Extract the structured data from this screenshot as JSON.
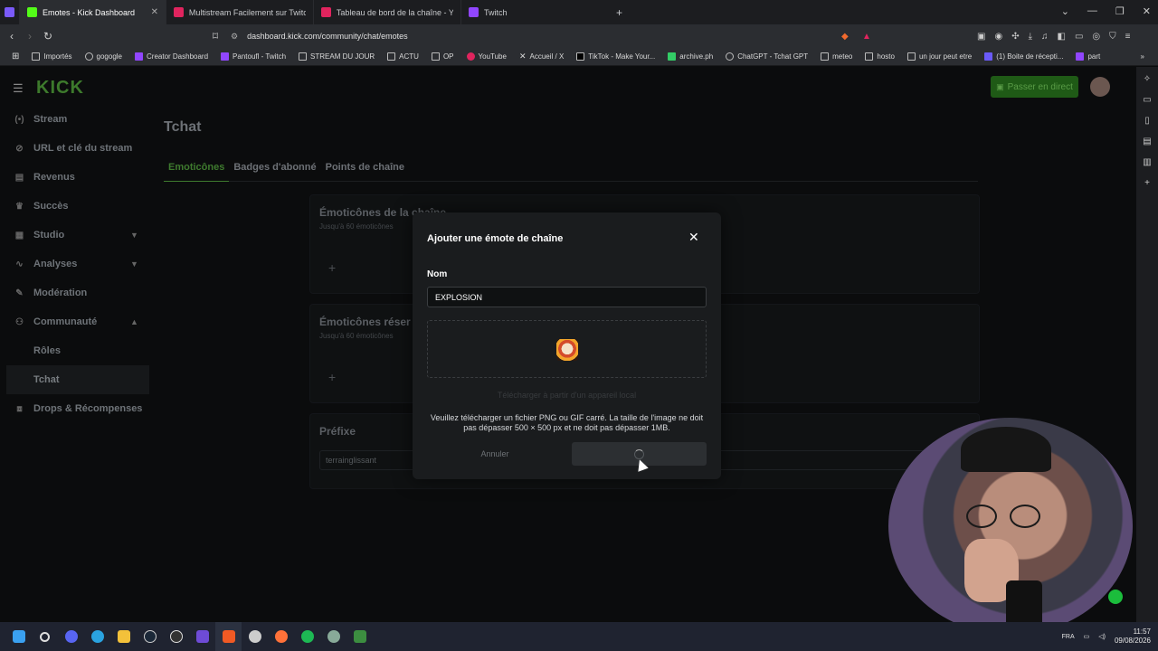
{
  "browser": {
    "tabs": [
      {
        "label": "Emotes - Kick Dashboard",
        "active": true,
        "color": "#53fc18"
      },
      {
        "label": "Multistream Facilement sur Twitch, Yo",
        "active": false,
        "color": "#e0245e"
      },
      {
        "label": "Tableau de bord de la chaîne - YouTu",
        "active": false,
        "color": "#e0245e"
      },
      {
        "label": "Twitch",
        "active": false,
        "color": "#9146ff"
      }
    ],
    "url": "dashboard.kick.com/community/chat/emotes",
    "bookmarks": [
      "Importés",
      "gogogle",
      "Creator Dashboard",
      "Pantoufl - Twitch",
      "STREAM DU JOUR",
      "ACTU",
      "OP",
      "YouTube",
      "Accueil / X",
      "TikTok - Make Your...",
      "archive.ph",
      "ChatGPT - Tchat GPT",
      "meteo",
      "hosto",
      "un jour peut etre",
      "(1) Boite de récepti...",
      "part"
    ]
  },
  "header": {
    "logo": "KICK",
    "go_live": "Passer en direct"
  },
  "nav": {
    "items": [
      {
        "label": "Stream",
        "icon": "(•)"
      },
      {
        "label": "URL et clé du stream",
        "icon": "⊘"
      },
      {
        "label": "Revenus",
        "icon": "▤"
      },
      {
        "label": "Succès",
        "icon": "♛"
      },
      {
        "label": "Studio",
        "icon": "▦"
      },
      {
        "label": "Analyses",
        "icon": "∿"
      },
      {
        "label": "Modération",
        "icon": "✎"
      },
      {
        "label": "Communauté",
        "icon": "⚇"
      },
      {
        "label": "Rôles",
        "icon": ""
      },
      {
        "label": "Tchat",
        "icon": ""
      },
      {
        "label": "Drops & Récompenses",
        "icon": "⧈"
      }
    ]
  },
  "page": {
    "title": "Tchat",
    "tabs": [
      "Emoticônes",
      "Badges d'abonné",
      "Points de chaîne"
    ],
    "cards": [
      {
        "title": "Émoticônes de la chaîne",
        "subtitle": "Jusqu'à 60 émoticônes"
      },
      {
        "title": "Émoticônes réser",
        "subtitle": "Jusqu'à 60 émoticônes"
      },
      {
        "title": "Préfixe",
        "value": "terrainglissant"
      }
    ]
  },
  "modal": {
    "title": "Ajouter une émote de chaîne",
    "name_label": "Nom",
    "name_value": "EXPLOSION",
    "upload_label": "Télécharger à partir d'un appareil local",
    "help_text": "Veuillez télécharger un fichier PNG ou GIF carré. La taille de l'image ne doit pas dépasser 500 × 500 px et ne doit pas dépasser 1MB.",
    "cancel": "Annuler"
  },
  "taskbar": {
    "lang": "FRA",
    "time": "11:57",
    "date": "09/08/2026"
  }
}
